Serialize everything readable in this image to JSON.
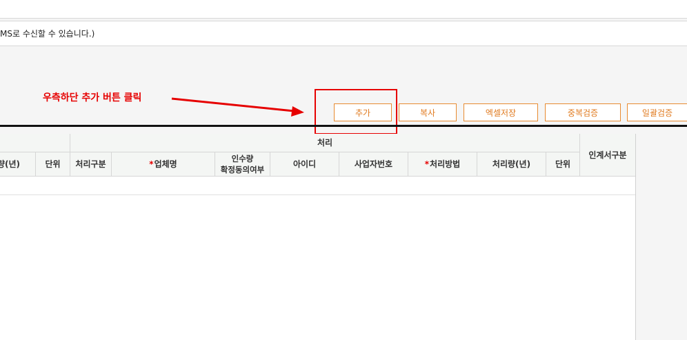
{
  "notice": {
    "text": "MS로 수신할 수 있습니다.)"
  },
  "annotation": {
    "text": "우측하단 추가 버튼 클릭",
    "color": "#e60000"
  },
  "toolbar": {
    "add_label": "추가",
    "copy_label": "복사",
    "excel_save_label": "엑셀저장",
    "duplicate_check_label": "중복검증",
    "batch_check_label": "일괄검증"
  },
  "table": {
    "group_header": "처리",
    "left_headers": {
      "amount": "량(년)",
      "unit": "단위"
    },
    "headers": {
      "process_type": "처리구분",
      "company_name": "업체명",
      "consent": "인수량\n확정동의여부",
      "user_id": "아이디",
      "business_number": "사업자번호",
      "process_method": "처리방법",
      "amount": "처리량(년)",
      "unit": "단위",
      "transfer_doc_type": "인계서구분"
    },
    "required_mark": "*"
  },
  "colors": {
    "accent_orange": "#e88a2f",
    "required_red": "#e60000"
  }
}
